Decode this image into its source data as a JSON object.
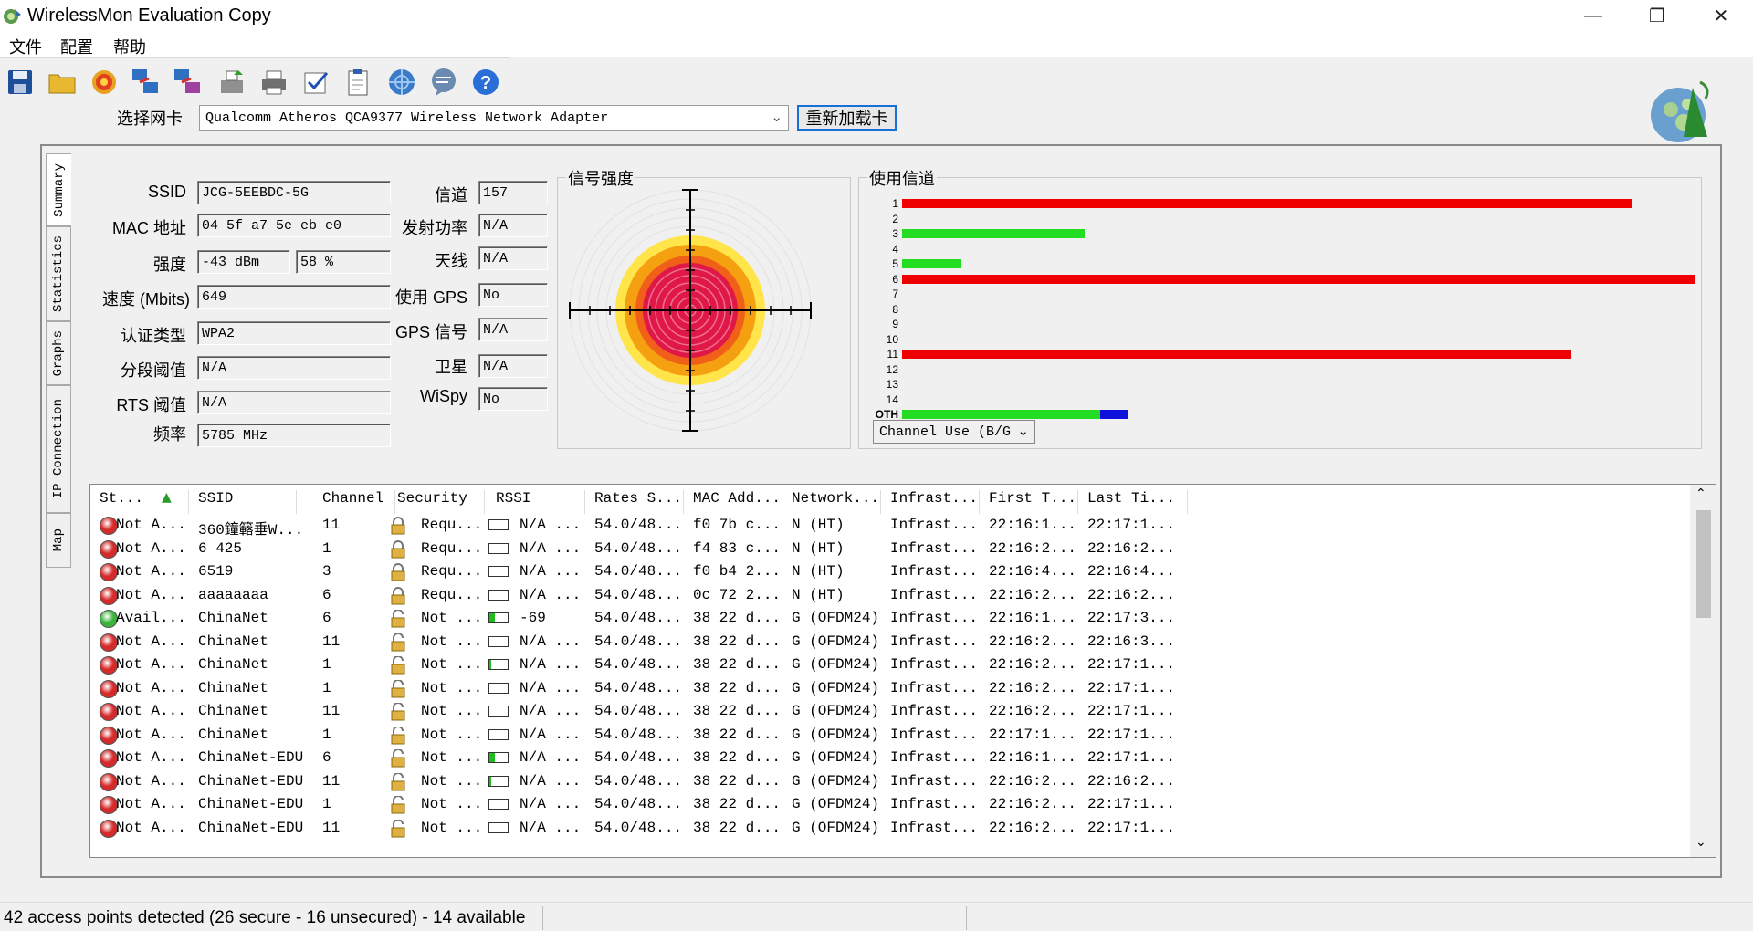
{
  "window": {
    "title": "WirelessMon Evaluation Copy"
  },
  "menu": [
    "文件",
    "配置",
    "帮助"
  ],
  "toolbar_icons": [
    "save-icon",
    "open-folder-icon",
    "target-icon",
    "network-compare-icon",
    "network-compare-2-icon",
    "export-icon",
    "print-icon",
    "validate-icon",
    "clipboard-icon",
    "globe-search-icon",
    "chat-icon",
    "help-icon"
  ],
  "adapter": {
    "label": "选择网卡",
    "selected": "Qualcomm Atheros QCA9377 Wireless Network Adapter",
    "reload_label": "重新加载卡"
  },
  "tabs": [
    "Summary",
    "Statistics",
    "Graphs",
    "IP Connection",
    "Map"
  ],
  "summary": {
    "left": [
      {
        "label": "SSID",
        "value": "JCG-5EEBDC-5G"
      },
      {
        "label": "MAC 地址",
        "value": "04 5f a7 5e eb e0"
      },
      {
        "label": "强度",
        "value": "-43 dBm",
        "value2": "58 %"
      },
      {
        "label": "速度 (Mbits)",
        "value": "649"
      },
      {
        "label": "认证类型",
        "value": "WPA2"
      },
      {
        "label": "分段阈值",
        "value": "N/A"
      },
      {
        "label": "RTS 阈值",
        "value": "N/A"
      },
      {
        "label": "频率",
        "value": "5785 MHz"
      }
    ],
    "right": [
      {
        "label": "信道",
        "value": "157"
      },
      {
        "label": "发射功率",
        "value": "N/A"
      },
      {
        "label": "天线",
        "value": "N/A"
      },
      {
        "label": "使用 GPS",
        "value": "No"
      },
      {
        "label": "GPS 信号",
        "value": "N/A"
      },
      {
        "label": "卫星",
        "value": "N/A"
      },
      {
        "label": "WiSpy",
        "value": "No"
      }
    ]
  },
  "signal_title": "信号强度",
  "channel_title": "使用信道",
  "channel_select": "Channel Use (B/G",
  "colors": {
    "red": "#ee0000",
    "green": "#22dd22",
    "blue": "#1010dd"
  },
  "channels": [
    {
      "label": "1",
      "segments": [
        {
          "color": "red",
          "value": 0.92
        }
      ]
    },
    {
      "label": "2",
      "segments": []
    },
    {
      "label": "3",
      "segments": [
        {
          "color": "green",
          "value": 0.23
        }
      ]
    },
    {
      "label": "4",
      "segments": []
    },
    {
      "label": "5",
      "segments": [
        {
          "color": "green",
          "value": 0.075
        }
      ]
    },
    {
      "label": "6",
      "segments": [
        {
          "color": "red",
          "value": 1.0
        }
      ]
    },
    {
      "label": "7",
      "segments": []
    },
    {
      "label": "8",
      "segments": []
    },
    {
      "label": "9",
      "segments": []
    },
    {
      "label": "10",
      "segments": []
    },
    {
      "label": "11",
      "segments": [
        {
          "color": "red",
          "value": 0.845
        }
      ]
    },
    {
      "label": "12",
      "segments": []
    },
    {
      "label": "13",
      "segments": []
    },
    {
      "label": "14",
      "segments": []
    },
    {
      "label": "OTH",
      "segments": [
        {
          "color": "green",
          "value": 0.25
        },
        {
          "color": "blue",
          "value": 0.035
        }
      ]
    }
  ],
  "list": {
    "headers": [
      "St...",
      "SSID",
      "Channel",
      "Security",
      "RSSI",
      "Rates S...",
      "MAC Add...",
      "Network...",
      "Infrast...",
      "First T...",
      "Last Ti..."
    ],
    "rows": [
      {
        "status": "red",
        "st": "Not A...",
        "ssid": "360鐘簵垂W...",
        "channel": "11",
        "security": "Requ...",
        "lock": "closed",
        "rssi_level": 0,
        "rssi": "N/A ...",
        "rates": "54.0/48...",
        "mac": "f0 7b c...",
        "network": "N (HT)",
        "infra": "Infrast...",
        "first": "22:16:1...",
        "last": "22:17:1..."
      },
      {
        "status": "red",
        "st": "Not A...",
        "ssid": "6 425",
        "channel": "1",
        "security": "Requ...",
        "lock": "closed",
        "rssi_level": 0,
        "rssi": "N/A ...",
        "rates": "54.0/48...",
        "mac": "f4 83 c...",
        "network": "N (HT)",
        "infra": "Infrast...",
        "first": "22:16:2...",
        "last": "22:16:2..."
      },
      {
        "status": "red",
        "st": "Not A...",
        "ssid": "6519",
        "channel": "3",
        "security": "Requ...",
        "lock": "closed",
        "rssi_level": 0,
        "rssi": "N/A ...",
        "rates": "54.0/48...",
        "mac": "f0 b4 2...",
        "network": "N (HT)",
        "infra": "Infrast...",
        "first": "22:16:4...",
        "last": "22:16:4..."
      },
      {
        "status": "red",
        "st": "Not A...",
        "ssid": "aaaaaaaa",
        "channel": "6",
        "security": "Requ...",
        "lock": "closed",
        "rssi_level": 0,
        "rssi": "N/A ...",
        "rates": "54.0/48...",
        "mac": "0c 72 2...",
        "network": "N (HT)",
        "infra": "Infrast...",
        "first": "22:16:2...",
        "last": "22:16:2..."
      },
      {
        "status": "green",
        "st": "Avail...",
        "ssid": "ChinaNet",
        "channel": "6",
        "security": "Not ...",
        "lock": "open",
        "rssi_level": 0.3,
        "rssi": "-69",
        "rates": "54.0/48...",
        "mac": "38 22 d...",
        "network": "G (OFDM24)",
        "infra": "Infrast...",
        "first": "22:16:1...",
        "last": "22:17:3..."
      },
      {
        "status": "red",
        "st": "Not A...",
        "ssid": "ChinaNet",
        "channel": "11",
        "security": "Not ...",
        "lock": "open",
        "rssi_level": 0,
        "rssi": "N/A ...",
        "rates": "54.0/48...",
        "mac": "38 22 d...",
        "network": "G (OFDM24)",
        "infra": "Infrast...",
        "first": "22:16:2...",
        "last": "22:16:3..."
      },
      {
        "status": "red",
        "st": "Not A...",
        "ssid": "ChinaNet",
        "channel": "1",
        "security": "Not ...",
        "lock": "open",
        "rssi_level": 0.1,
        "rssi": "N/A ...",
        "rates": "54.0/48...",
        "mac": "38 22 d...",
        "network": "G (OFDM24)",
        "infra": "Infrast...",
        "first": "22:16:2...",
        "last": "22:17:1..."
      },
      {
        "status": "red",
        "st": "Not A...",
        "ssid": "ChinaNet",
        "channel": "1",
        "security": "Not ...",
        "lock": "open",
        "rssi_level": 0,
        "rssi": "N/A ...",
        "rates": "54.0/48...",
        "mac": "38 22 d...",
        "network": "G (OFDM24)",
        "infra": "Infrast...",
        "first": "22:16:2...",
        "last": "22:17:1..."
      },
      {
        "status": "red",
        "st": "Not A...",
        "ssid": "ChinaNet",
        "channel": "11",
        "security": "Not ...",
        "lock": "open",
        "rssi_level": 0,
        "rssi": "N/A ...",
        "rates": "54.0/48...",
        "mac": "38 22 d...",
        "network": "G (OFDM24)",
        "infra": "Infrast...",
        "first": "22:16:2...",
        "last": "22:17:1..."
      },
      {
        "status": "red",
        "st": "Not A...",
        "ssid": "ChinaNet",
        "channel": "1",
        "security": "Not ...",
        "lock": "open",
        "rssi_level": 0,
        "rssi": "N/A ...",
        "rates": "54.0/48...",
        "mac": "38 22 d...",
        "network": "G (OFDM24)",
        "infra": "Infrast...",
        "first": "22:17:1...",
        "last": "22:17:1..."
      },
      {
        "status": "red",
        "st": "Not A...",
        "ssid": "ChinaNet-EDU",
        "channel": "6",
        "security": "Not ...",
        "lock": "open",
        "rssi_level": 0.3,
        "rssi": "N/A ...",
        "rates": "54.0/48...",
        "mac": "38 22 d...",
        "network": "G (OFDM24)",
        "infra": "Infrast...",
        "first": "22:16:1...",
        "last": "22:17:1..."
      },
      {
        "status": "red",
        "st": "Not A...",
        "ssid": "ChinaNet-EDU",
        "channel": "11",
        "security": "Not ...",
        "lock": "open",
        "rssi_level": 0.1,
        "rssi": "N/A ...",
        "rates": "54.0/48...",
        "mac": "38 22 d...",
        "network": "G (OFDM24)",
        "infra": "Infrast...",
        "first": "22:16:2...",
        "last": "22:16:2..."
      },
      {
        "status": "red",
        "st": "Not A...",
        "ssid": "ChinaNet-EDU",
        "channel": "1",
        "security": "Not ...",
        "lock": "open",
        "rssi_level": 0,
        "rssi": "N/A ...",
        "rates": "54.0/48...",
        "mac": "38 22 d...",
        "network": "G (OFDM24)",
        "infra": "Infrast...",
        "first": "22:16:2...",
        "last": "22:17:1..."
      },
      {
        "status": "red",
        "st": "Not A...",
        "ssid": "ChinaNet-EDU",
        "channel": "11",
        "security": "Not ...",
        "lock": "open",
        "rssi_level": 0,
        "rssi": "N/A ...",
        "rates": "54.0/48...",
        "mac": "38 22 d...",
        "network": "G (OFDM24)",
        "infra": "Infrast...",
        "first": "22:16:2...",
        "last": "22:17:1..."
      }
    ]
  },
  "status": "42 access points detected (26 secure - 16 unsecured) - 14 available"
}
